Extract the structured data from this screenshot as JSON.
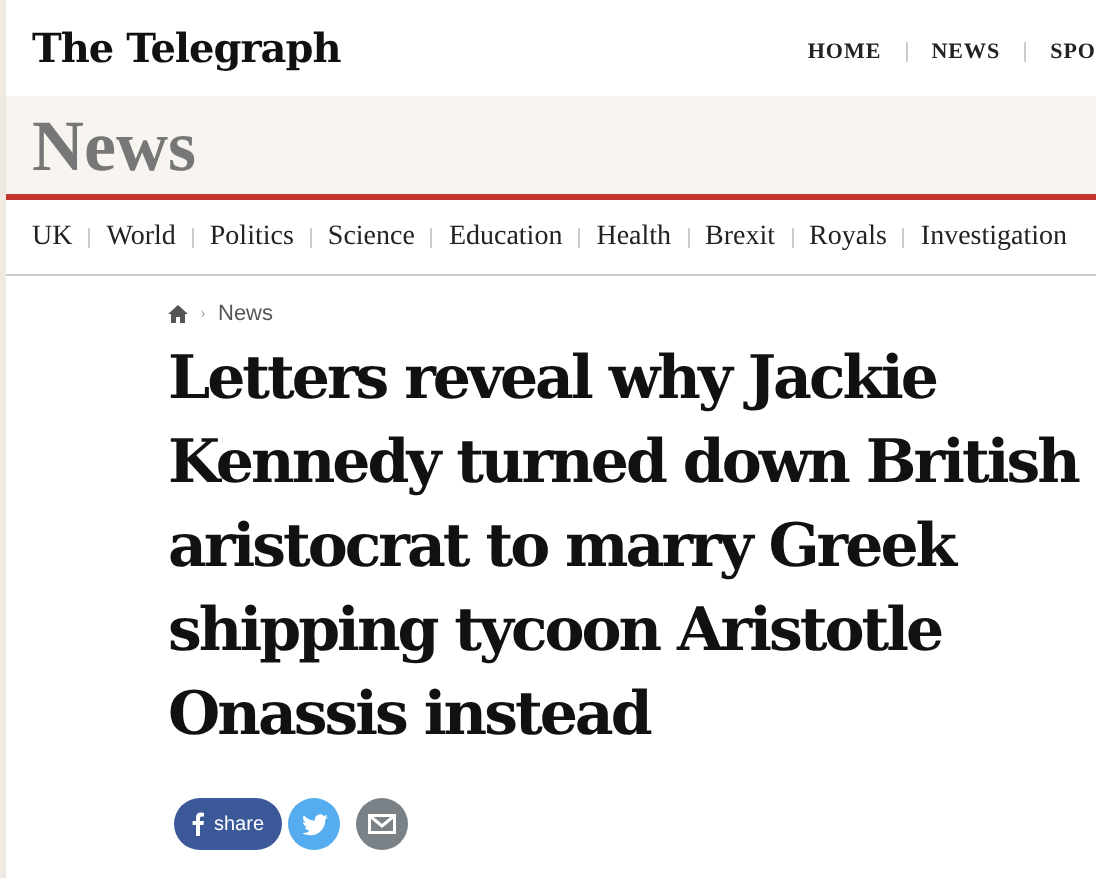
{
  "masthead": {
    "logo": "The Telegraph",
    "nav": [
      "HOME",
      "NEWS",
      "SPO"
    ]
  },
  "section": {
    "title": "News"
  },
  "subnav": [
    "UK",
    "World",
    "Politics",
    "Science",
    "Education",
    "Health",
    "Brexit",
    "Royals",
    "Investigation"
  ],
  "breadcrumb": {
    "separator": "›",
    "current": "News"
  },
  "headline": "Letters reveal why Jackie Kennedy turned down British aristocrat to marry Greek shipping tycoon Aristotle Onassis instead",
  "share": [
    {
      "kind": "facebook",
      "label": "share"
    },
    {
      "kind": "twitter"
    },
    {
      "kind": "email"
    }
  ]
}
